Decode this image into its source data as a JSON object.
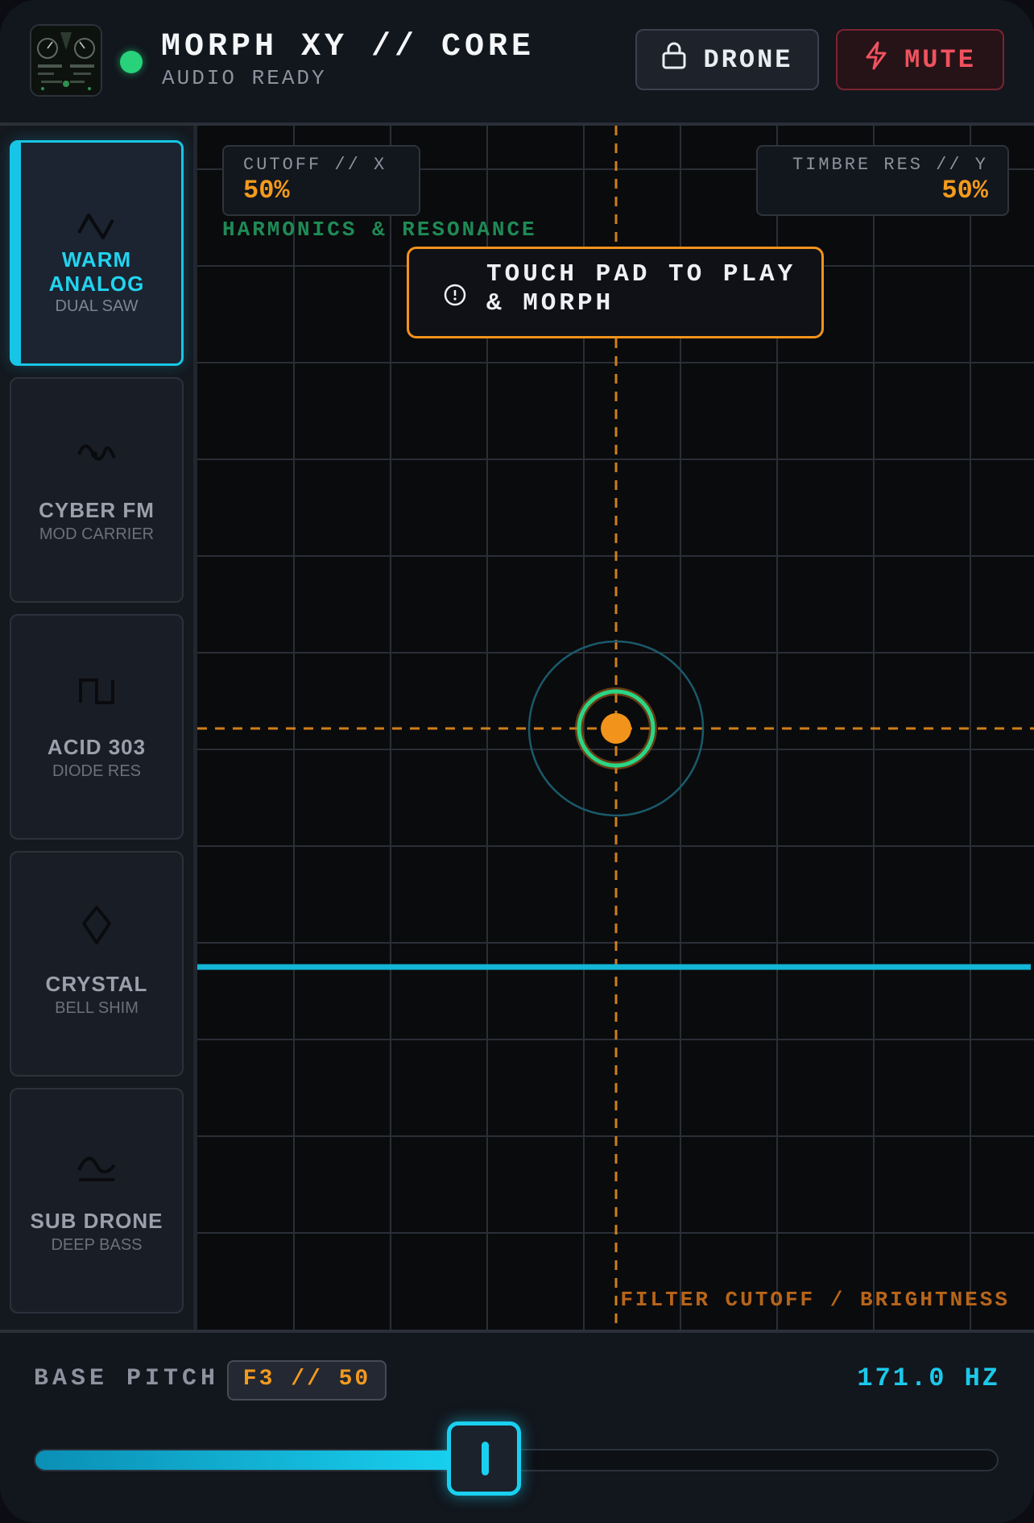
{
  "header": {
    "title": "MORPH XY // CORE",
    "status": "AUDIO READY",
    "status_color": "#27d27b",
    "drone_label": "DRONE",
    "drone_icon": "lock-icon",
    "mute_label": "MUTE",
    "mute_icon": "lightning-icon"
  },
  "presets": [
    {
      "name": "WARM ANALOG",
      "sub": "DUAL SAW",
      "icon": "sawtooth-wave-icon",
      "active": true
    },
    {
      "name": "CYBER FM",
      "sub": "MOD CARRIER",
      "icon": "fm-wave-icon",
      "active": false
    },
    {
      "name": "ACID 303",
      "sub": "DIODE RES",
      "icon": "square-wave-icon",
      "active": false
    },
    {
      "name": "CRYSTAL",
      "sub": "BELL SHIM",
      "icon": "crystal-icon",
      "active": false
    },
    {
      "name": "SUB DRONE",
      "sub": "DEEP BASS",
      "icon": "sine-wave-icon",
      "active": false
    }
  ],
  "pad": {
    "x_label": "CUTOFF // X",
    "x_value": "50%",
    "y_label": "TIMBRE RES // Y",
    "y_value": "50%",
    "y_axis_title": "HARMONICS & RESONANCE",
    "x_axis_title": "FILTER CUTOFF / BRIGHTNESS",
    "hint": "TOUCH PAD TO PLAY & MORPH",
    "hint_icon": "info-icon",
    "cursor_x": 0.5,
    "cursor_y": 0.5
  },
  "pitch": {
    "label": "BASE PITCH",
    "note": "F3 // 50",
    "hz": "171.0 HZ",
    "slider_value": 0.5
  },
  "colors": {
    "accent_cyan": "#17c6e6",
    "accent_orange": "#f2931b",
    "mute_red": "#f0525e",
    "grid": "#2a2e36"
  }
}
